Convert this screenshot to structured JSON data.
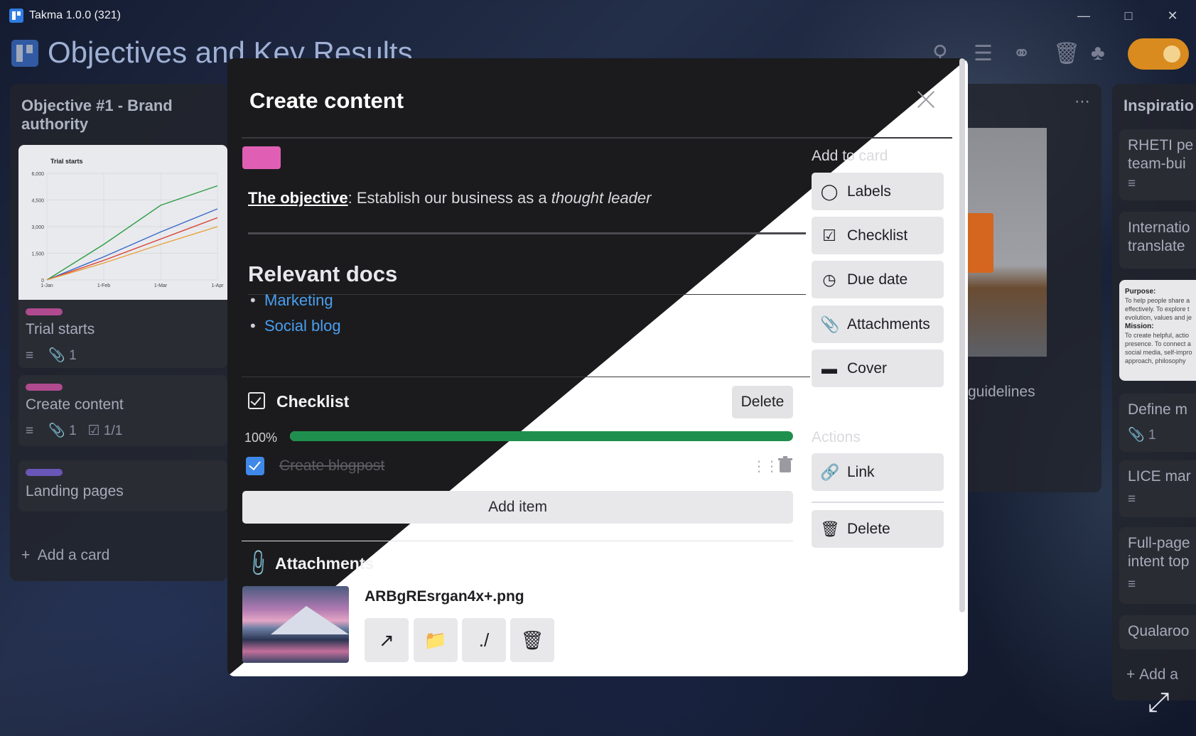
{
  "window": {
    "title": "Takma 1.0.0 (321)"
  },
  "board": {
    "title": "Objectives and Key Results"
  },
  "left_list": {
    "title": "Objective #1 - Brand authority",
    "cards": [
      {
        "title": "Trial starts",
        "attachments": "1",
        "label_color": "#b04a8f"
      },
      {
        "title": "Create content",
        "attachments": "1",
        "checklist": "1/1",
        "label_color": "#b04a8f"
      },
      {
        "title": "Landing pages",
        "label_color": "#6a55b8"
      }
    ],
    "add_card": "Add a card"
  },
  "cover_chart": {
    "chart_data": {
      "type": "line",
      "title": "Trial starts",
      "categories": [
        "1-Jan",
        "1-Feb",
        "1-Mar",
        "1-Apr"
      ],
      "yticks": [
        "0",
        "1,500",
        "3,000",
        "4,500",
        "6,000"
      ],
      "ylim": [
        0,
        6000
      ],
      "series": [
        {
          "values": [
            0,
            2000,
            4200,
            5300
          ],
          "color": "#2e9e45"
        },
        {
          "values": [
            0,
            1300,
            2700,
            4000
          ],
          "color": "#3a68c9"
        },
        {
          "values": [
            0,
            1100,
            2300,
            3500
          ],
          "color": "#d9402f"
        },
        {
          "values": [
            0,
            950,
            2000,
            3000
          ],
          "color": "#e6a23a"
        }
      ]
    }
  },
  "middle_list": {
    "card_title_fragment": "guidelines"
  },
  "right_list": {
    "title": "Inspiratio",
    "cards": [
      {
        "title_line1": "RHETI pe",
        "title_line2": "team-bui"
      },
      {
        "title_line1": "Internatio",
        "title_line2": "translate"
      },
      {
        "purpose_heading": "Purpose:",
        "purpose_text": "To help people share a effectively. To explore t evolution, values and je",
        "mission_heading": "Mission:",
        "mission_text": "To create helpful, actio presence. To connect a social media, self-impro approach, philosophy"
      },
      {
        "title_line1": "Define m",
        "attachments": "1"
      },
      {
        "title_line1": "LICE mar"
      },
      {
        "title_line1": "Full-page",
        "title_line2": "intent top"
      },
      {
        "title_line1": "Qualaroo"
      }
    ],
    "add_card": "Add a"
  },
  "modal": {
    "title": "Create content",
    "label_color": "#e05fb4",
    "description": {
      "link": "The objective",
      "prefix": ": Establish our business as a ",
      "italic": "thought leader"
    },
    "relevant_docs": {
      "heading": "Relevant docs",
      "items": [
        "Marketing",
        "Social blog"
      ]
    },
    "checklist": {
      "heading": "Checklist",
      "delete_label": "Delete",
      "percent": "100%",
      "progress": 1.0,
      "items": [
        {
          "text": "Create blogpost",
          "checked": true
        }
      ],
      "add_item_label": "Add item"
    },
    "attachments": {
      "heading": "Attachments",
      "file_name": "ARBgREsrgan4x+.png",
      "relative_path_label": "./"
    },
    "add_to_card": {
      "heading": "Add to card",
      "buttons": [
        "Labels",
        "Checklist",
        "Due date",
        "Attachments",
        "Cover"
      ]
    },
    "actions": {
      "heading": "Actions",
      "buttons": [
        "Link",
        "Delete"
      ]
    }
  }
}
